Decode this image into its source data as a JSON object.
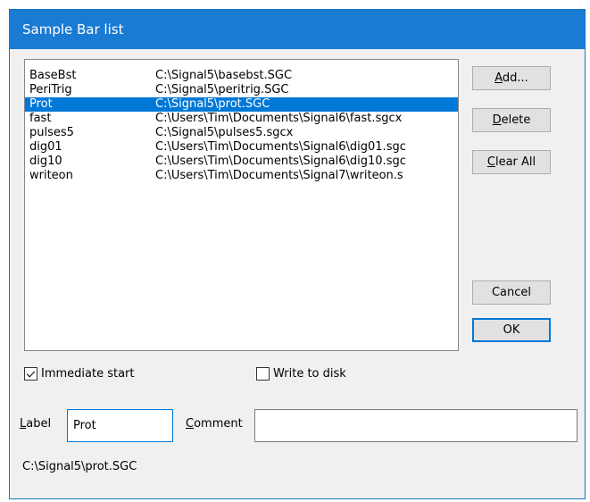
{
  "window": {
    "title": "Sample Bar list"
  },
  "list": {
    "items": [
      {
        "name": "BaseBst",
        "path": "C:\\Signal5\\basebst.SGC",
        "selected": false
      },
      {
        "name": "PeriTrig",
        "path": "C:\\Signal5\\peritrig.SGC",
        "selected": false
      },
      {
        "name": "Prot",
        "path": "C:\\Signal5\\prot.SGC",
        "selected": true
      },
      {
        "name": "fast",
        "path": "C:\\Users\\Tim\\Documents\\Signal6\\fast.sgcx",
        "selected": false
      },
      {
        "name": "pulses5",
        "path": "C:\\Signal5\\pulses5.sgcx",
        "selected": false
      },
      {
        "name": "dig01",
        "path": "C:\\Users\\Tim\\Documents\\Signal6\\dig01.sgc",
        "selected": false
      },
      {
        "name": "dig10",
        "path": "C:\\Users\\Tim\\Documents\\Signal6\\dig10.sgc",
        "selected": false
      },
      {
        "name": "writeon",
        "path": "C:\\Users\\Tim\\Documents\\Signal7\\writeon.s",
        "selected": false
      }
    ]
  },
  "buttons": {
    "add": {
      "pre": "",
      "u": "A",
      "post": "dd..."
    },
    "delete": {
      "pre": "",
      "u": "D",
      "post": "elete"
    },
    "clear_all": {
      "pre": "",
      "u": "C",
      "post": "lear All"
    },
    "cancel": "Cancel",
    "ok": "OK"
  },
  "options": {
    "immediate_start": {
      "label": "Immediate start",
      "checked": true
    },
    "write_to_disk": {
      "label": "Write to disk",
      "checked": false
    }
  },
  "fields": {
    "label": {
      "pre": "",
      "u": "L",
      "post": "abel",
      "value": "Prot"
    },
    "comment": {
      "pre": "",
      "u": "C",
      "post": "omment",
      "value": ""
    }
  },
  "status": {
    "path": "C:\\Signal5\\prot.SGC"
  }
}
